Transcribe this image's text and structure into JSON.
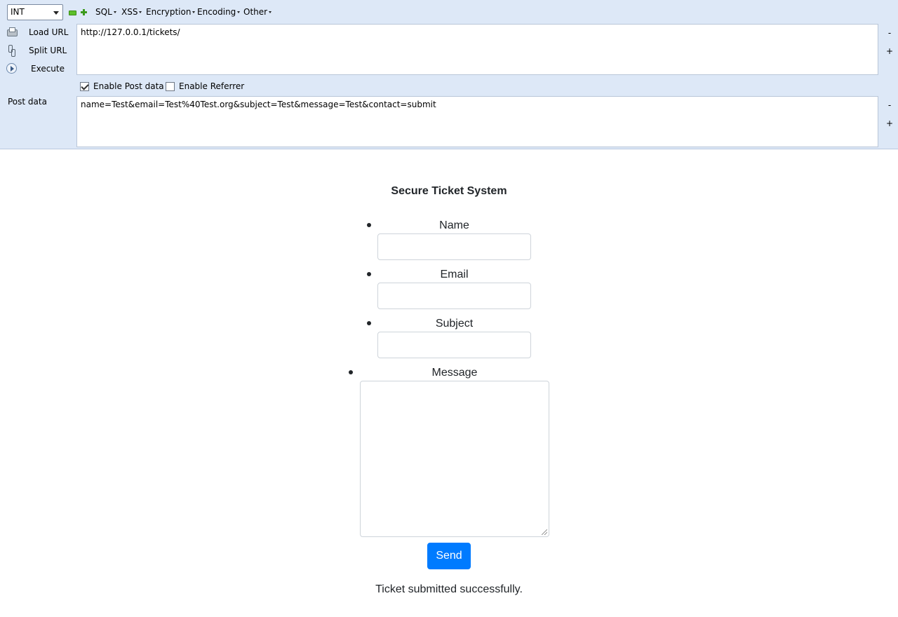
{
  "hackbar": {
    "type_select": "INT",
    "menus": {
      "sql": "SQL",
      "xss": "XSS",
      "encryption": "Encryption",
      "encoding": "Encoding",
      "other": "Other"
    },
    "actions": {
      "load_url": "Load URL",
      "split_url": "Split URL",
      "execute": "Execute"
    },
    "url_value": "http://127.0.0.1/tickets/",
    "enable_post_data": {
      "label": "Enable Post data",
      "checked": true
    },
    "enable_referrer": {
      "label": "Enable Referrer",
      "checked": false
    },
    "post_data_label": "Post data",
    "post_data_value": "name=Test&email=Test%40Test.org&subject=Test&message=Test&contact=submit",
    "shrink_label": "-",
    "grow_label": "+"
  },
  "page": {
    "title": "Secure Ticket System",
    "fields": {
      "name": {
        "label": "Name",
        "value": ""
      },
      "email": {
        "label": "Email",
        "value": ""
      },
      "subject": {
        "label": "Subject",
        "value": ""
      },
      "message": {
        "label": "Message",
        "value": ""
      }
    },
    "send_button": "Send",
    "status_message": "Ticket submitted successfully.",
    "accent_color": "#007bff"
  }
}
